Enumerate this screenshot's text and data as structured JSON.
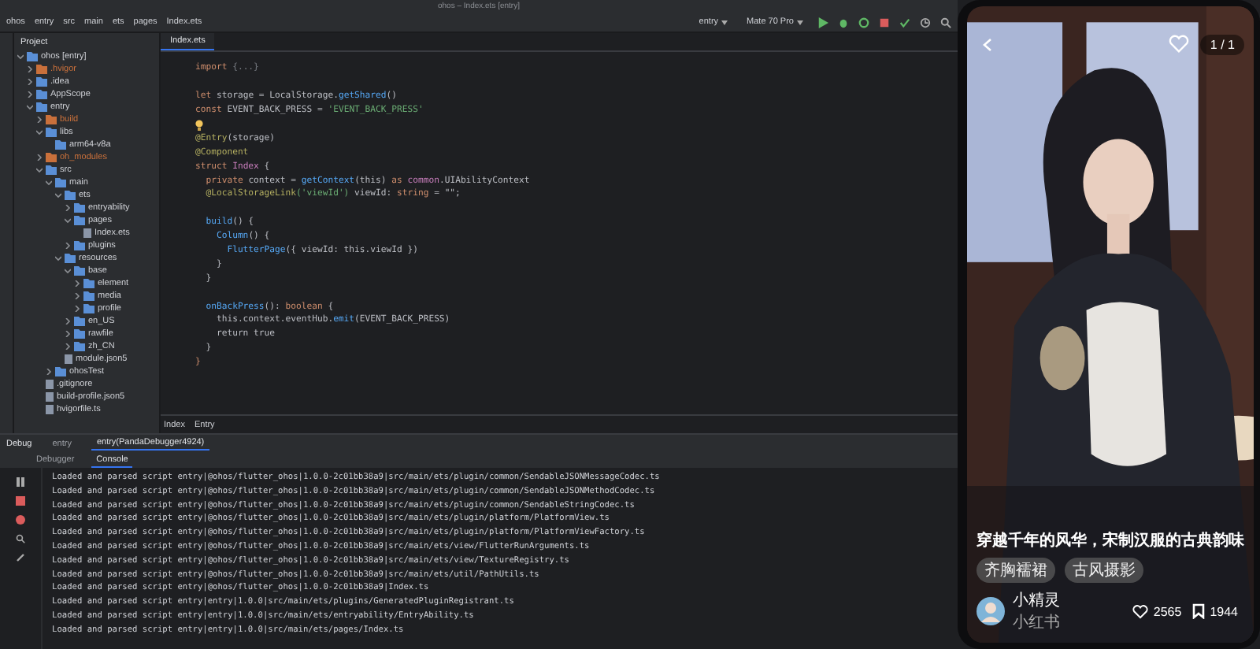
{
  "window": {
    "title": "ohos – Index.ets [entry]"
  },
  "breadcrumbs": [
    "ohos",
    "entry",
    "src",
    "main",
    "ets",
    "pages",
    "Index.ets"
  ],
  "run_config": "entry",
  "device": "Mate 70 Pro",
  "project_panel": {
    "title": "Project",
    "tree": [
      {
        "label": "ohos [entry]",
        "kind": "folder",
        "expanded": true,
        "children": [
          {
            "label": ".hvigor",
            "kind": "folder",
            "highlighted": true,
            "expanded": false
          },
          {
            "label": ".idea",
            "kind": "folder",
            "expanded": false
          },
          {
            "label": "AppScope",
            "kind": "folder",
            "expanded": false
          },
          {
            "label": "entry",
            "kind": "folder",
            "expanded": true,
            "children": [
              {
                "label": "build",
                "kind": "folder",
                "highlighted": true,
                "expanded": false
              },
              {
                "label": "libs",
                "kind": "folder",
                "expanded": true,
                "children": [
                  {
                    "label": "arm64-v8a",
                    "kind": "folder"
                  }
                ]
              },
              {
                "label": "oh_modules",
                "kind": "folder",
                "highlighted": true,
                "expanded": false
              },
              {
                "label": "src",
                "kind": "folder",
                "expanded": true,
                "children": [
                  {
                    "label": "main",
                    "kind": "folder",
                    "expanded": true,
                    "children": [
                      {
                        "label": "ets",
                        "kind": "folder",
                        "expanded": true,
                        "children": [
                          {
                            "label": "entryability",
                            "kind": "folder",
                            "expanded": false
                          },
                          {
                            "label": "pages",
                            "kind": "folder",
                            "expanded": true,
                            "children": [
                              {
                                "label": "Index.ets",
                                "kind": "file"
                              }
                            ]
                          },
                          {
                            "label": "plugins",
                            "kind": "folder",
                            "expanded": false
                          }
                        ]
                      },
                      {
                        "label": "resources",
                        "kind": "folder",
                        "expanded": true,
                        "children": [
                          {
                            "label": "base",
                            "kind": "folder",
                            "expanded": true,
                            "children": [
                              {
                                "label": "element",
                                "kind": "folder",
                                "expanded": false
                              },
                              {
                                "label": "media",
                                "kind": "folder",
                                "expanded": false
                              },
                              {
                                "label": "profile",
                                "kind": "folder",
                                "expanded": false
                              }
                            ]
                          },
                          {
                            "label": "en_US",
                            "kind": "folder",
                            "expanded": false
                          },
                          {
                            "label": "rawfile",
                            "kind": "folder",
                            "expanded": false
                          },
                          {
                            "label": "zh_CN",
                            "kind": "folder",
                            "expanded": false
                          }
                        ]
                      },
                      {
                        "label": "module.json5",
                        "kind": "file"
                      }
                    ]
                  },
                  {
                    "label": "ohosTest",
                    "kind": "folder",
                    "expanded": false
                  }
                ]
              },
              {
                "label": ".gitignore",
                "kind": "file"
              },
              {
                "label": "build-profile.json5",
                "kind": "file"
              },
              {
                "label": "hvigorfile.ts",
                "kind": "file"
              }
            ]
          }
        ]
      }
    ]
  },
  "editor": {
    "tabs": [
      {
        "label": "Index.ets",
        "selected": true
      }
    ],
    "lines": [
      {
        "tokens": [
          {
            "t": "import ",
            "kind": "kw"
          },
          {
            "t": "{...}",
            "kind": "fold"
          }
        ]
      },
      {
        "blank_before": true,
        "tokens": [
          {
            "t": "let ",
            "kind": "kw"
          },
          {
            "t": "storage = LocalStorage.",
            "kind": "plain"
          },
          {
            "t": "getShared",
            "kind": "fn"
          },
          {
            "t": "()",
            "kind": "plain"
          }
        ]
      },
      {
        "tokens": [
          {
            "t": "const ",
            "kind": "kw"
          },
          {
            "t": "EVENT_BACK_PRESS = ",
            "kind": "plain"
          },
          {
            "t": "'EVENT_BACK_PRESS'",
            "kind": "str"
          }
        ]
      },
      {
        "hint_before": true,
        "tokens": [
          {
            "t": "@Entry",
            "kind": "ann"
          },
          {
            "t": "(storage)",
            "kind": "plain"
          }
        ]
      },
      {
        "tokens": [
          {
            "t": "@Component",
            "kind": "ann"
          }
        ]
      },
      {
        "tokens": [
          {
            "t": "struct ",
            "kind": "kw"
          },
          {
            "t": "Index ",
            "kind": "type"
          },
          {
            "t": "{",
            "kind": "plain"
          }
        ]
      },
      {
        "tokens": [
          {
            "t": "  private ",
            "kind": "kw"
          },
          {
            "t": "context = ",
            "kind": "plain"
          },
          {
            "t": "getContext",
            "kind": "fn"
          },
          {
            "t": "(this) ",
            "kind": "plain"
          },
          {
            "t": "as ",
            "kind": "kw"
          },
          {
            "t": "common",
            "kind": "type"
          },
          {
            "t": ".UIAbilityContext",
            "kind": "plain"
          }
        ]
      },
      {
        "tokens": [
          {
            "t": "  @LocalStorageLink",
            "kind": "ann"
          },
          {
            "t": "('viewId') ",
            "kind": "str"
          },
          {
            "t": "viewId: ",
            "kind": "plain"
          },
          {
            "t": "string ",
            "kind": "kw"
          },
          {
            "t": "= \"\";",
            "kind": "plain"
          }
        ]
      },
      {
        "blank_before": true,
        "tokens": [
          {
            "t": "  build",
            "kind": "fn"
          },
          {
            "t": "() {",
            "kind": "plain"
          }
        ]
      },
      {
        "tokens": [
          {
            "t": "    Column",
            "kind": "fn"
          },
          {
            "t": "() {",
            "kind": "plain"
          }
        ]
      },
      {
        "tokens": [
          {
            "t": "      FlutterPage",
            "kind": "fn"
          },
          {
            "t": "({ viewId: this.viewId })",
            "kind": "plain"
          }
        ]
      },
      {
        "tokens": [
          {
            "t": "    }",
            "kind": "plain"
          }
        ]
      },
      {
        "tokens": [
          {
            "t": "  }",
            "kind": "plain"
          }
        ]
      },
      {
        "blank_before": true,
        "tokens": [
          {
            "t": "  onBackPress",
            "kind": "fn"
          },
          {
            "t": "(): ",
            "kind": "plain"
          },
          {
            "t": "boolean ",
            "kind": "kw"
          },
          {
            "t": "{",
            "kind": "plain"
          }
        ]
      },
      {
        "tokens": [
          {
            "t": "    this.context.eventHub.",
            "kind": "plain"
          },
          {
            "t": "emit",
            "kind": "fn"
          },
          {
            "t": "(EVENT_BACK_PRESS)",
            "kind": "plain"
          }
        ]
      },
      {
        "tokens": [
          {
            "t": "    return true",
            "kind": "plain"
          }
        ]
      },
      {
        "tokens": [
          {
            "t": "  }",
            "kind": "plain"
          }
        ]
      },
      {
        "tokens": [
          {
            "t": "}",
            "kind": "kw"
          }
        ]
      }
    ],
    "footer": [
      "Index",
      "Entry"
    ]
  },
  "debug": {
    "title": "Debug",
    "sessions": [
      {
        "label": "entry",
        "selected": false
      },
      {
        "label": "entry(PandaDebugger4924)",
        "selected": true
      }
    ],
    "tabs": [
      {
        "label": "Debugger",
        "selected": false
      },
      {
        "label": "Console",
        "selected": true
      }
    ],
    "console": [
      "Loaded and parsed script entry|@ohos/flutter_ohos|1.0.0-2c01bb38a9|src/main/ets/plugin/common/SendableJSONMessageCodec.ts",
      "Loaded and parsed script entry|@ohos/flutter_ohos|1.0.0-2c01bb38a9|src/main/ets/plugin/common/SendableJSONMethodCodec.ts",
      "Loaded and parsed script entry|@ohos/flutter_ohos|1.0.0-2c01bb38a9|src/main/ets/plugin/common/SendableStringCodec.ts",
      "Loaded and parsed script entry|@ohos/flutter_ohos|1.0.0-2c01bb38a9|src/main/ets/plugin/platform/PlatformView.ts",
      "Loaded and parsed script entry|@ohos/flutter_ohos|1.0.0-2c01bb38a9|src/main/ets/plugin/platform/PlatformViewFactory.ts",
      "Loaded and parsed script entry|@ohos/flutter_ohos|1.0.0-2c01bb38a9|src/main/ets/view/FlutterRunArguments.ts",
      "Loaded and parsed script entry|@ohos/flutter_ohos|1.0.0-2c01bb38a9|src/main/ets/view/TextureRegistry.ts",
      "Loaded and parsed script entry|@ohos/flutter_ohos|1.0.0-2c01bb38a9|src/main/ets/util/PathUtils.ts",
      "Loaded and parsed script entry|@ohos/flutter_ohos|1.0.0-2c01bb38a9|Index.ts",
      "Loaded and parsed script entry|entry|1.0.0|src/main/ets/plugins/GeneratedPluginRegistrant.ts",
      "Loaded and parsed script entry|entry|1.0.0|src/main/ets/entryability/EntryAbility.ts",
      "Loaded and parsed script entry|entry|1.0.0|src/main/ets/pages/Index.ts"
    ]
  },
  "phone": {
    "liked": false,
    "counter": "1 / 1",
    "caption": "穿越千年的风华，宋制汉服的古典韵味",
    "tags": [
      "齐胸襦裙",
      "古风摄影"
    ],
    "author": {
      "name": "小精灵",
      "source": "小红书"
    },
    "likes": "2565",
    "saves": "1944"
  }
}
